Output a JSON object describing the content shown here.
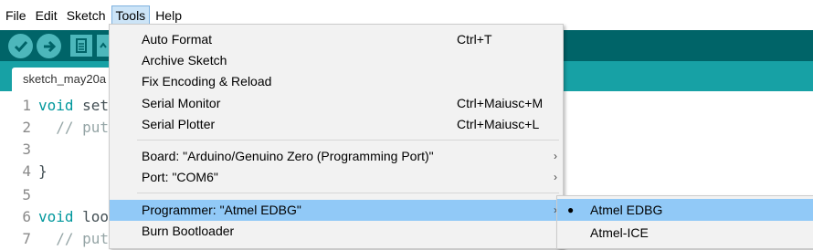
{
  "menubar": {
    "items": [
      "File",
      "Edit",
      "Sketch",
      "Tools",
      "Help"
    ]
  },
  "tab": {
    "label": "sketch_may20a"
  },
  "editor": {
    "lines": [
      {
        "num": "1",
        "kw": "void",
        "rest": " set"
      },
      {
        "num": "2",
        "kw": "",
        "rest": "  // put"
      },
      {
        "num": "3",
        "kw": "",
        "rest": ""
      },
      {
        "num": "4",
        "kw": "",
        "rest": "}"
      },
      {
        "num": "5",
        "kw": "",
        "rest": ""
      },
      {
        "num": "6",
        "kw": "void",
        "rest": " loo"
      },
      {
        "num": "7",
        "kw": "",
        "rest": "  // put"
      }
    ]
  },
  "tools_menu": {
    "items": [
      {
        "label": "Auto Format",
        "shortcut": "Ctrl+T"
      },
      {
        "label": "Archive Sketch",
        "shortcut": ""
      },
      {
        "label": "Fix Encoding & Reload",
        "shortcut": ""
      },
      {
        "label": "Serial Monitor",
        "shortcut": "Ctrl+Maiusc+M"
      },
      {
        "label": "Serial Plotter",
        "shortcut": "Ctrl+Maiusc+L"
      },
      {
        "label": "Board: \"Arduino/Genuino Zero (Programming Port)\"",
        "arrow": "›"
      },
      {
        "label": "Port: \"COM6\"",
        "arrow": "›"
      },
      {
        "label": "Programmer: \"Atmel EDBG\"",
        "arrow": "›"
      },
      {
        "label": "Burn Bootloader",
        "shortcut": ""
      }
    ]
  },
  "programmer_submenu": {
    "items": [
      {
        "label": "Atmel EDBG",
        "bullet": "●"
      },
      {
        "label": "Atmel-ICE",
        "bullet": ""
      }
    ]
  },
  "colors": {
    "toolbar": "#006468",
    "tabstrip": "#17a1a5",
    "highlight": "#91c9f7"
  }
}
